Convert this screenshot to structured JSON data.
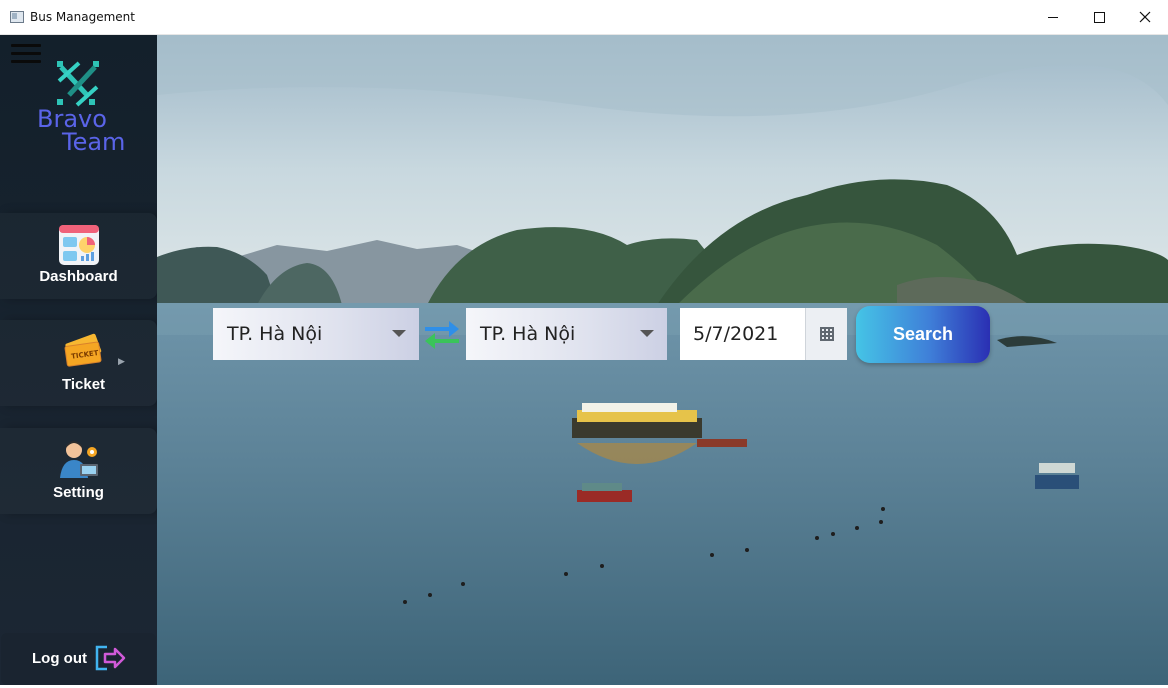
{
  "window": {
    "title": "Bus Management"
  },
  "sidebar": {
    "logo": {
      "line1": "Bravo",
      "line2": "Team"
    },
    "items": [
      {
        "label": "Dashboard",
        "icon": "dashboard-icon"
      },
      {
        "label": "Ticket",
        "icon": "ticket-icon",
        "has_submenu": true
      },
      {
        "label": "Setting",
        "icon": "admin-user-icon"
      }
    ],
    "logout": {
      "label": "Log out",
      "icon": "logout-icon"
    }
  },
  "search_form": {
    "from": {
      "value": "TP. Hà Nội"
    },
    "to": {
      "value": "TP. Hà Nội"
    },
    "swap_icon": "swap-arrows-icon",
    "date": {
      "value": "5/7/2021",
      "icon": "calendar-icon"
    },
    "search_label": "Search"
  },
  "colors": {
    "sidebar_bg": "#18232f",
    "brand": "#5a64e8",
    "search_gradient_start": "#45c4e6",
    "search_gradient_end": "#2a2fb3"
  }
}
